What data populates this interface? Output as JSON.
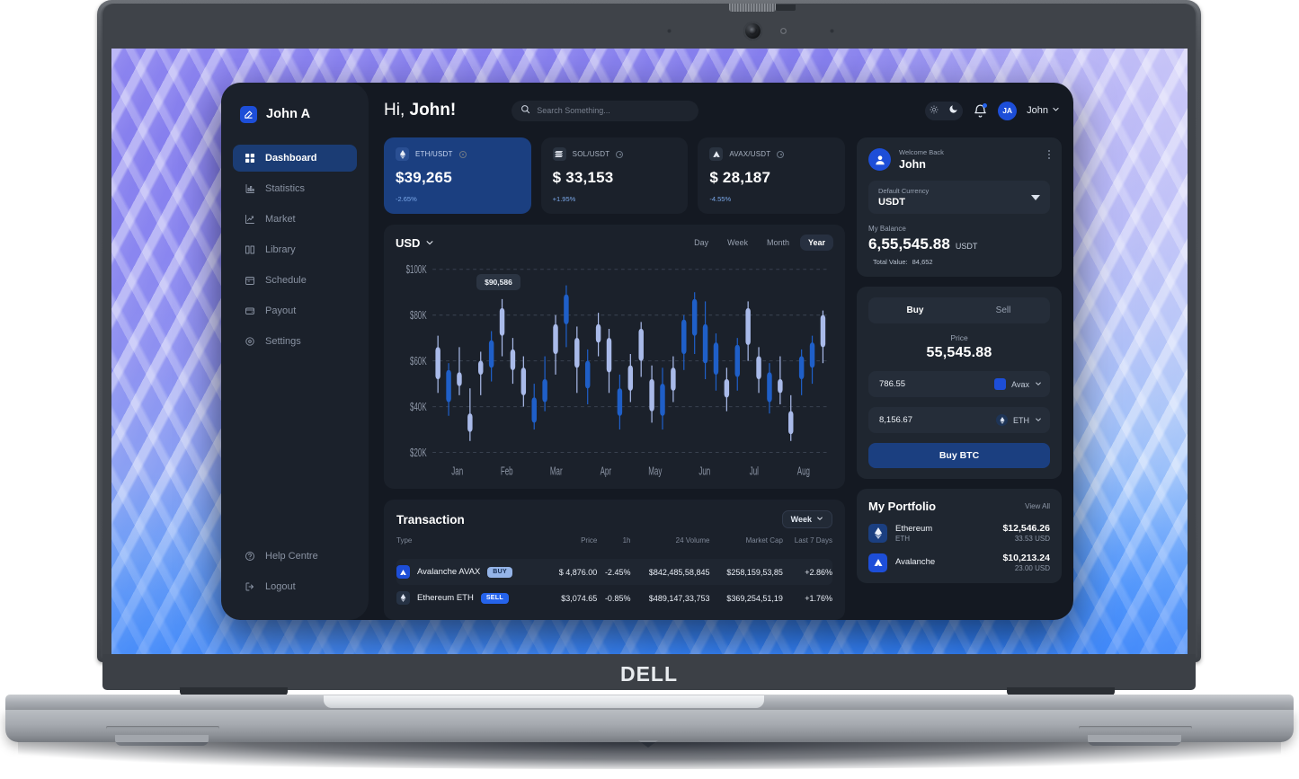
{
  "device": {
    "brand": "DELL"
  },
  "sidebar": {
    "brand_name": "John A",
    "items": [
      {
        "label": "Dashboard",
        "icon": "grid-icon",
        "active": true
      },
      {
        "label": "Statistics",
        "icon": "bar-chart-icon",
        "active": false
      },
      {
        "label": "Market",
        "icon": "trend-line-icon",
        "active": false
      },
      {
        "label": "Library",
        "icon": "book-icon",
        "active": false
      },
      {
        "label": "Schedule",
        "icon": "calendar-icon",
        "active": false
      },
      {
        "label": "Payout",
        "icon": "wallet-icon",
        "active": false
      },
      {
        "label": "Settings",
        "icon": "gear-icon",
        "active": false
      }
    ],
    "bottom_items": [
      {
        "label": "Help Centre",
        "icon": "question-circle-icon"
      },
      {
        "label": "Logout",
        "icon": "logout-icon"
      }
    ]
  },
  "header": {
    "greeting_prefix": "Hi, ",
    "greeting_name": "John!",
    "search_placeholder": "Search Something...",
    "search_value": "",
    "avatar_initials": "JA",
    "user_name": "John"
  },
  "price_cards": [
    {
      "pair": "ETH/USDT",
      "value": "$39,265",
      "change": "-2.65%",
      "highlight": true,
      "icon": "ethereum-icon"
    },
    {
      "pair": "SOL/USDT",
      "value": "$ 33,153",
      "change": "+1.95%",
      "highlight": false,
      "icon": "solana-icon"
    },
    {
      "pair": "AVAX/USDT",
      "value": "$ 28,187",
      "change": "-4.55%",
      "highlight": false,
      "icon": "avalanche-icon"
    }
  ],
  "chart_card": {
    "currency": "USD",
    "ranges": [
      "Day",
      "Week",
      "Month",
      "Year"
    ],
    "active_range": "Year",
    "tooltip": "$90,586"
  },
  "chart_data": {
    "type": "candlestick",
    "title": "USD",
    "xlabel": "",
    "ylabel": "",
    "ylim": [
      20000,
      100000
    ],
    "ytick_labels": [
      "$100K",
      "$80K",
      "$60K",
      "$40K",
      "$20K"
    ],
    "ytick_values": [
      100000,
      80000,
      60000,
      40000,
      20000
    ],
    "grid": true,
    "legend": "none",
    "categories": [
      "Jan",
      "Feb",
      "Mar",
      "Apr",
      "May",
      "Jun",
      "Jul",
      "Aug"
    ],
    "annotation": {
      "label": "$90,586",
      "x_index": 4
    },
    "colors": {
      "up": "#a9bae9",
      "down": "#1f5fc8"
    },
    "candles": [
      {
        "open": 52000,
        "close": 66000,
        "low": 46000,
        "high": 71000,
        "dir": "up"
      },
      {
        "open": 56000,
        "close": 42000,
        "low": 36000,
        "high": 59000,
        "dir": "down"
      },
      {
        "open": 55000,
        "close": 49000,
        "low": 45000,
        "high": 66000,
        "dir": "up"
      },
      {
        "open": 37000,
        "close": 29000,
        "low": 25000,
        "high": 48000,
        "dir": "up"
      },
      {
        "open": 60000,
        "close": 54000,
        "low": 45000,
        "high": 64000,
        "dir": "up"
      },
      {
        "open": 69000,
        "close": 57000,
        "low": 51000,
        "high": 73000,
        "dir": "down"
      },
      {
        "open": 83000,
        "close": 71000,
        "low": 62000,
        "high": 87000,
        "dir": "up"
      },
      {
        "open": 65000,
        "close": 56000,
        "low": 50000,
        "high": 70000,
        "dir": "up"
      },
      {
        "open": 57000,
        "close": 45000,
        "low": 40000,
        "high": 62000,
        "dir": "up"
      },
      {
        "open": 44000,
        "close": 33000,
        "low": 30000,
        "high": 50000,
        "dir": "down"
      },
      {
        "open": 52000,
        "close": 42000,
        "low": 38000,
        "high": 62000,
        "dir": "down"
      },
      {
        "open": 76000,
        "close": 63000,
        "low": 54000,
        "high": 80000,
        "dir": "up"
      },
      {
        "open": 89000,
        "close": 76000,
        "low": 66000,
        "high": 93000,
        "dir": "down"
      },
      {
        "open": 70000,
        "close": 57000,
        "low": 46000,
        "high": 75000,
        "dir": "up"
      },
      {
        "open": 60000,
        "close": 48000,
        "low": 41000,
        "high": 65000,
        "dir": "down"
      },
      {
        "open": 76000,
        "close": 68000,
        "low": 62000,
        "high": 81000,
        "dir": "up"
      },
      {
        "open": 70000,
        "close": 55000,
        "low": 46000,
        "high": 74000,
        "dir": "up"
      },
      {
        "open": 48000,
        "close": 36000,
        "low": 30000,
        "high": 54000,
        "dir": "down"
      },
      {
        "open": 58000,
        "close": 47000,
        "low": 42000,
        "high": 63000,
        "dir": "up"
      },
      {
        "open": 74000,
        "close": 60000,
        "low": 53000,
        "high": 77000,
        "dir": "up"
      },
      {
        "open": 52000,
        "close": 38000,
        "low": 33000,
        "high": 58000,
        "dir": "up"
      },
      {
        "open": 50000,
        "close": 36000,
        "low": 30000,
        "high": 57000,
        "dir": "down"
      },
      {
        "open": 57000,
        "close": 47000,
        "low": 42000,
        "high": 62000,
        "dir": "up"
      },
      {
        "open": 78000,
        "close": 63000,
        "low": 56000,
        "high": 80000,
        "dir": "down"
      },
      {
        "open": 87000,
        "close": 71000,
        "low": 63000,
        "high": 90000,
        "dir": "down"
      },
      {
        "open": 76000,
        "close": 59000,
        "low": 52000,
        "high": 86000,
        "dir": "down"
      },
      {
        "open": 68000,
        "close": 54000,
        "low": 47000,
        "high": 72000,
        "dir": "down"
      },
      {
        "open": 52000,
        "close": 44000,
        "low": 38000,
        "high": 57000,
        "dir": "up"
      },
      {
        "open": 67000,
        "close": 53000,
        "low": 47000,
        "high": 70000,
        "dir": "down"
      },
      {
        "open": 83000,
        "close": 67000,
        "low": 60000,
        "high": 86000,
        "dir": "up"
      },
      {
        "open": 62000,
        "close": 52000,
        "low": 46000,
        "high": 66000,
        "dir": "up"
      },
      {
        "open": 55000,
        "close": 42000,
        "low": 37000,
        "high": 59000,
        "dir": "down"
      },
      {
        "open": 52000,
        "close": 46000,
        "low": 41000,
        "high": 62000,
        "dir": "up"
      },
      {
        "open": 38000,
        "close": 28000,
        "low": 25000,
        "high": 45000,
        "dir": "up"
      },
      {
        "open": 62000,
        "close": 52000,
        "low": 45000,
        "high": 65000,
        "dir": "down"
      },
      {
        "open": 68000,
        "close": 57000,
        "low": 50000,
        "high": 71000,
        "dir": "down"
      },
      {
        "open": 80000,
        "close": 66000,
        "low": 59000,
        "high": 82000,
        "dir": "up"
      }
    ]
  },
  "transaction": {
    "title": "Transaction",
    "range_label": "Week",
    "columns": [
      "Type",
      "Price",
      "1h",
      "24 Volume",
      "Market Cap",
      "Last 7 Days"
    ],
    "rows": [
      {
        "asset": "Avalanche AVAX",
        "tag": "BUY",
        "tag_kind": "buy",
        "icon": "avalanche-icon",
        "price": "$ 4,876.00",
        "h1": "-2.45%",
        "volume": "$842,485,58,845",
        "market_cap": "$258,159,53,85",
        "last7": "+2.86%",
        "highlighted": true
      },
      {
        "asset": "Ethereum ETH",
        "tag": "SELL",
        "tag_kind": "sell",
        "icon": "ethereum-icon",
        "price": "$3,074.65",
        "h1": "-0.85%",
        "volume": "$489,147,33,753",
        "market_cap": "$369,254,51,19",
        "last7": "+1.76%",
        "highlighted": false
      }
    ]
  },
  "welcome_card": {
    "label": "Welcome Back",
    "name": "John",
    "currency_label": "Default Currency",
    "currency_value": "USDT",
    "balance_label": "My Balance",
    "balance_value": "6,55,545.88",
    "balance_currency": "USDT",
    "total_label": "Total Value:",
    "total_value": "84,652"
  },
  "trade_card": {
    "tabs": [
      "Buy",
      "Sell"
    ],
    "active_tab": "Buy",
    "price_label": "Price",
    "price_value": "55,545.88",
    "amount_1": "786.55",
    "currency_1": "Avax",
    "amount_2": "8,156.67",
    "currency_2": "ETH",
    "action_label": "Buy BTC"
  },
  "portfolio": {
    "title": "My Portfolio",
    "view_all": "View All",
    "items": [
      {
        "name": "Ethereum",
        "symbol": "ETH",
        "value": "$12,546.26",
        "sub": "33.53 USD",
        "icon": "ethereum-icon"
      },
      {
        "name": "Avalanche",
        "symbol": "",
        "value": "$10,213.24",
        "sub": "23.00 USD",
        "icon": "avalanche-icon"
      }
    ]
  },
  "colors": {
    "accent": "#1d4ed8",
    "accent_dark": "#1b3f80",
    "panel": "#1b212b",
    "panel_alt": "#1f2630",
    "app_bg": "#141922",
    "candle_up": "#a9bae9",
    "candle_down": "#1f5fc8"
  }
}
